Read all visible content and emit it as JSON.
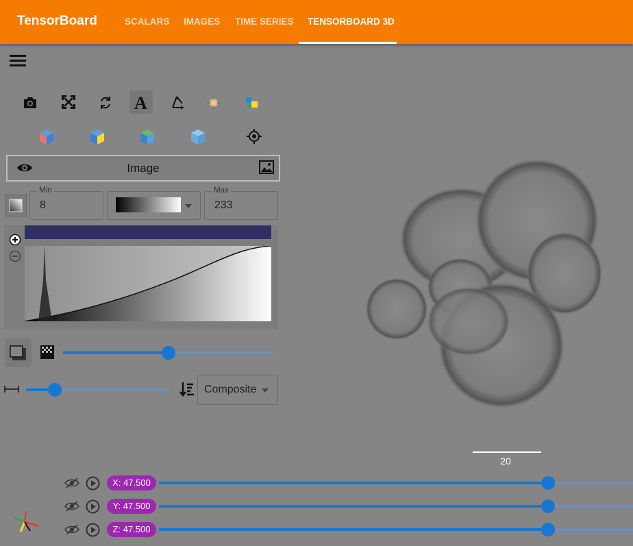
{
  "app": {
    "title": "TensorBoard"
  },
  "tabs": [
    {
      "label": "SCALARS"
    },
    {
      "label": "IMAGES"
    },
    {
      "label": "TIME SERIES"
    },
    {
      "label": "TENSORBOARD 3D",
      "active": true
    }
  ],
  "toolbar_icons": [
    "camera-icon",
    "fullscreen-icon",
    "rotate-icon",
    "text-label-icon",
    "axes-icon",
    "lighting-icon",
    "colors-icon"
  ],
  "view_cubes": [
    "cube-view-red-icon",
    "cube-view-yellow-icon",
    "cube-view-green-icon",
    "cube-view-plain-icon",
    "center-target-icon"
  ],
  "layer": {
    "label": "Image"
  },
  "range": {
    "min_label": "Min",
    "min_value": "8",
    "max_label": "Max",
    "max_value": "233"
  },
  "render": {
    "mode": "Composite",
    "opacity_level": 0.5,
    "step_level": 0.2
  },
  "scale_bar": {
    "label": "20"
  },
  "slices": [
    {
      "axis": "x",
      "label": "X: 47.500",
      "position": 0.8
    },
    {
      "axis": "y",
      "label": "Y: 47.500",
      "position": 0.8
    },
    {
      "axis": "z",
      "label": "Z: 47.500",
      "position": 0.8
    }
  ],
  "colors": {
    "header": "#f57c00",
    "accent": "#1976d2",
    "chip": "#9c27b0",
    "background": "#858585"
  }
}
